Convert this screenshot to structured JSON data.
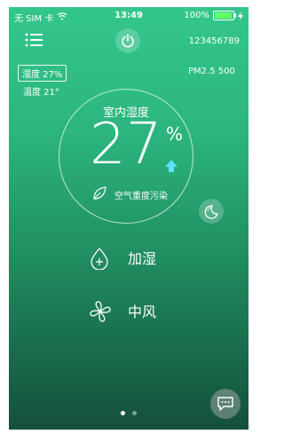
{
  "status_bar": {
    "carrier": "无 SIM 卡",
    "time": "13:49",
    "battery_text": "100%",
    "battery_level": 1.0,
    "battery_color": "#64ff64"
  },
  "header": {
    "menu_icon": "list-menu-icon",
    "power_icon": "power-icon",
    "device_id": "123456789"
  },
  "sensors": {
    "humidity_badge": "湿度 27%",
    "temperature": "温度 21°",
    "pm": "PM2.5 500"
  },
  "gauge": {
    "title": "室内湿度",
    "value": "27",
    "unit": "%",
    "trend_icon": "up-arrow-icon",
    "trend_color": "#5ee0ff",
    "leaf_icon": "leaf-icon",
    "status": "空气重度污染"
  },
  "sleep": {
    "icon": "moon-zzz-icon"
  },
  "actions": [
    {
      "label": "加湿",
      "icon": "droplet-plus-icon"
    },
    {
      "label": "中风",
      "icon": "fan-icon"
    }
  ],
  "chat": {
    "icon": "chat-bubble-icon"
  },
  "pager": {
    "pages": 2,
    "active": 0
  }
}
